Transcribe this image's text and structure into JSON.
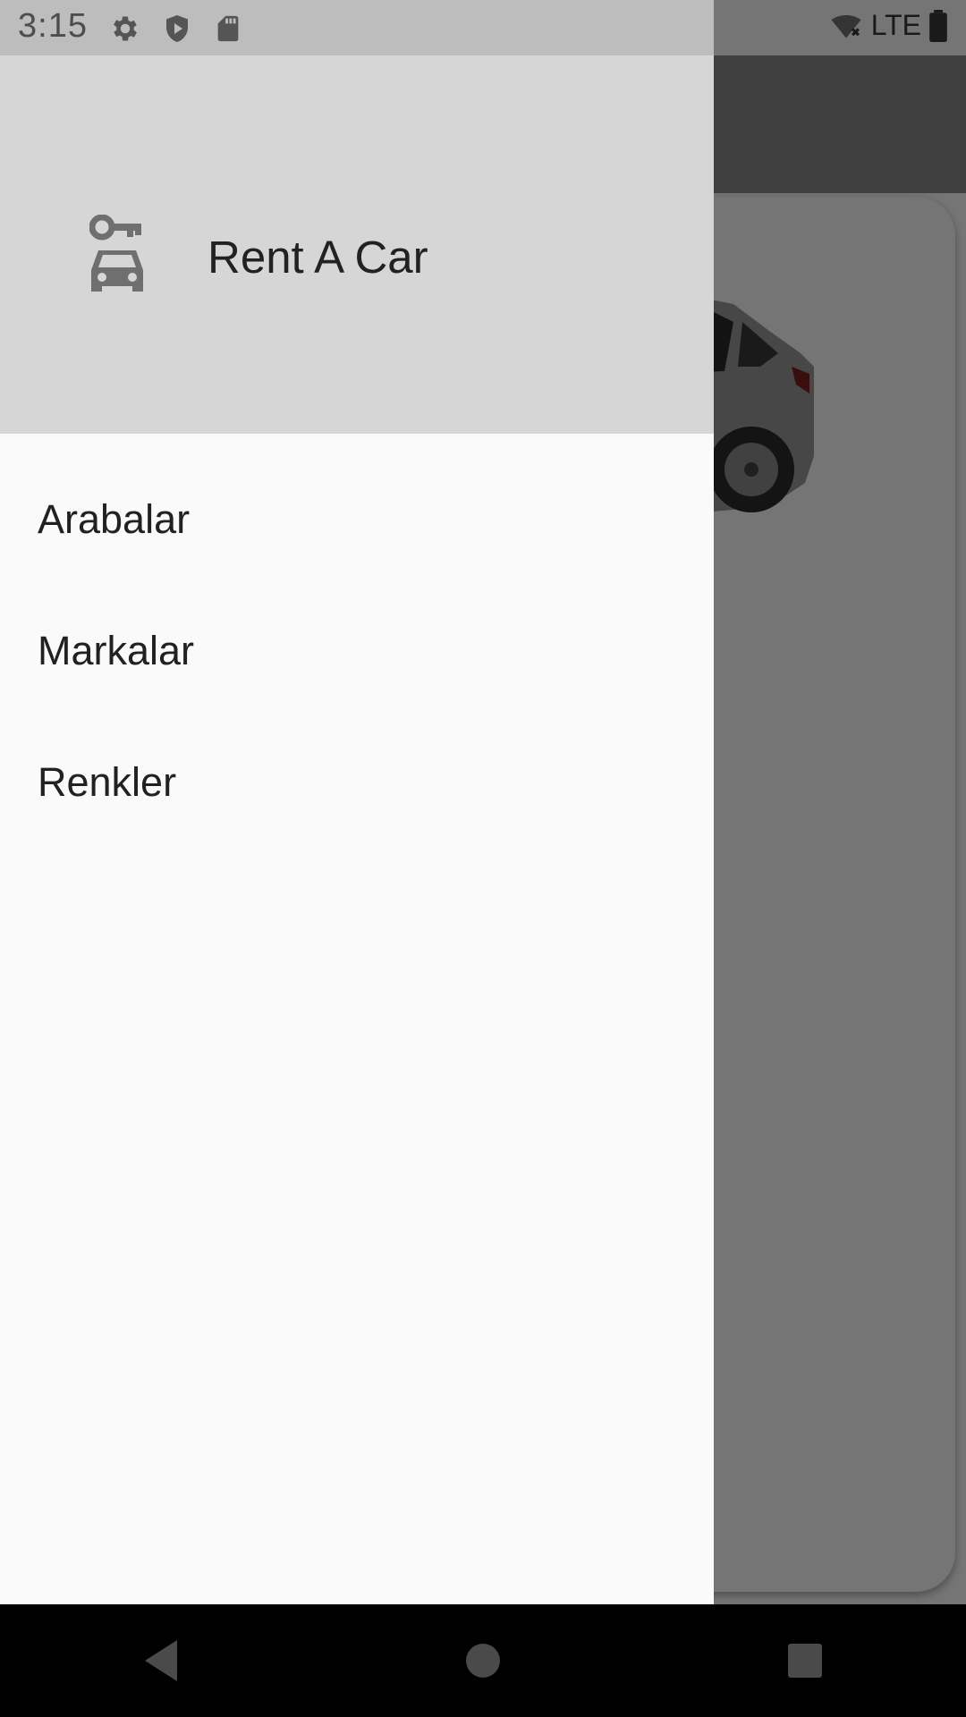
{
  "status_bar": {
    "time": "3:15",
    "icons": [
      "gear-icon",
      "shield-play-icon",
      "sd-card-icon"
    ],
    "network": "LTE",
    "right_icons": [
      "wifi-off-icon",
      "battery-icon"
    ]
  },
  "drawer": {
    "header": {
      "icon": "car-key-icon",
      "title": "Rent A Car"
    },
    "items": [
      {
        "label": "Arabalar"
      },
      {
        "label": "Markalar"
      },
      {
        "label": "Renkler"
      }
    ]
  },
  "nav_bar": {
    "buttons": [
      "back-icon",
      "home-icon",
      "recents-icon"
    ]
  },
  "colors": {
    "header_bg": "#d6d6d6",
    "drawer_bg": "#fafafa",
    "text": "#212121"
  }
}
